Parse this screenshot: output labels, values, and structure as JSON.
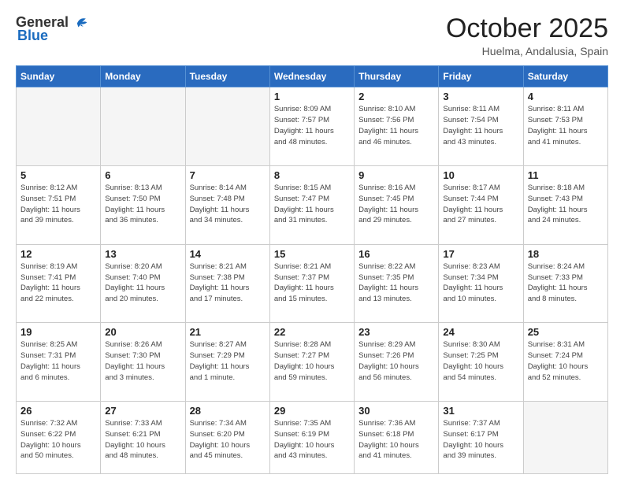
{
  "header": {
    "logo_general": "General",
    "logo_blue": "Blue",
    "month_title": "October 2025",
    "location": "Huelma, Andalusia, Spain"
  },
  "weekdays": [
    "Sunday",
    "Monday",
    "Tuesday",
    "Wednesday",
    "Thursday",
    "Friday",
    "Saturday"
  ],
  "weeks": [
    [
      {
        "day": "",
        "info": ""
      },
      {
        "day": "",
        "info": ""
      },
      {
        "day": "",
        "info": ""
      },
      {
        "day": "1",
        "info": "Sunrise: 8:09 AM\nSunset: 7:57 PM\nDaylight: 11 hours\nand 48 minutes."
      },
      {
        "day": "2",
        "info": "Sunrise: 8:10 AM\nSunset: 7:56 PM\nDaylight: 11 hours\nand 46 minutes."
      },
      {
        "day": "3",
        "info": "Sunrise: 8:11 AM\nSunset: 7:54 PM\nDaylight: 11 hours\nand 43 minutes."
      },
      {
        "day": "4",
        "info": "Sunrise: 8:11 AM\nSunset: 7:53 PM\nDaylight: 11 hours\nand 41 minutes."
      }
    ],
    [
      {
        "day": "5",
        "info": "Sunrise: 8:12 AM\nSunset: 7:51 PM\nDaylight: 11 hours\nand 39 minutes."
      },
      {
        "day": "6",
        "info": "Sunrise: 8:13 AM\nSunset: 7:50 PM\nDaylight: 11 hours\nand 36 minutes."
      },
      {
        "day": "7",
        "info": "Sunrise: 8:14 AM\nSunset: 7:48 PM\nDaylight: 11 hours\nand 34 minutes."
      },
      {
        "day": "8",
        "info": "Sunrise: 8:15 AM\nSunset: 7:47 PM\nDaylight: 11 hours\nand 31 minutes."
      },
      {
        "day": "9",
        "info": "Sunrise: 8:16 AM\nSunset: 7:45 PM\nDaylight: 11 hours\nand 29 minutes."
      },
      {
        "day": "10",
        "info": "Sunrise: 8:17 AM\nSunset: 7:44 PM\nDaylight: 11 hours\nand 27 minutes."
      },
      {
        "day": "11",
        "info": "Sunrise: 8:18 AM\nSunset: 7:43 PM\nDaylight: 11 hours\nand 24 minutes."
      }
    ],
    [
      {
        "day": "12",
        "info": "Sunrise: 8:19 AM\nSunset: 7:41 PM\nDaylight: 11 hours\nand 22 minutes."
      },
      {
        "day": "13",
        "info": "Sunrise: 8:20 AM\nSunset: 7:40 PM\nDaylight: 11 hours\nand 20 minutes."
      },
      {
        "day": "14",
        "info": "Sunrise: 8:21 AM\nSunset: 7:38 PM\nDaylight: 11 hours\nand 17 minutes."
      },
      {
        "day": "15",
        "info": "Sunrise: 8:21 AM\nSunset: 7:37 PM\nDaylight: 11 hours\nand 15 minutes."
      },
      {
        "day": "16",
        "info": "Sunrise: 8:22 AM\nSunset: 7:35 PM\nDaylight: 11 hours\nand 13 minutes."
      },
      {
        "day": "17",
        "info": "Sunrise: 8:23 AM\nSunset: 7:34 PM\nDaylight: 11 hours\nand 10 minutes."
      },
      {
        "day": "18",
        "info": "Sunrise: 8:24 AM\nSunset: 7:33 PM\nDaylight: 11 hours\nand 8 minutes."
      }
    ],
    [
      {
        "day": "19",
        "info": "Sunrise: 8:25 AM\nSunset: 7:31 PM\nDaylight: 11 hours\nand 6 minutes."
      },
      {
        "day": "20",
        "info": "Sunrise: 8:26 AM\nSunset: 7:30 PM\nDaylight: 11 hours\nand 3 minutes."
      },
      {
        "day": "21",
        "info": "Sunrise: 8:27 AM\nSunset: 7:29 PM\nDaylight: 11 hours\nand 1 minute."
      },
      {
        "day": "22",
        "info": "Sunrise: 8:28 AM\nSunset: 7:27 PM\nDaylight: 10 hours\nand 59 minutes."
      },
      {
        "day": "23",
        "info": "Sunrise: 8:29 AM\nSunset: 7:26 PM\nDaylight: 10 hours\nand 56 minutes."
      },
      {
        "day": "24",
        "info": "Sunrise: 8:30 AM\nSunset: 7:25 PM\nDaylight: 10 hours\nand 54 minutes."
      },
      {
        "day": "25",
        "info": "Sunrise: 8:31 AM\nSunset: 7:24 PM\nDaylight: 10 hours\nand 52 minutes."
      }
    ],
    [
      {
        "day": "26",
        "info": "Sunrise: 7:32 AM\nSunset: 6:22 PM\nDaylight: 10 hours\nand 50 minutes."
      },
      {
        "day": "27",
        "info": "Sunrise: 7:33 AM\nSunset: 6:21 PM\nDaylight: 10 hours\nand 48 minutes."
      },
      {
        "day": "28",
        "info": "Sunrise: 7:34 AM\nSunset: 6:20 PM\nDaylight: 10 hours\nand 45 minutes."
      },
      {
        "day": "29",
        "info": "Sunrise: 7:35 AM\nSunset: 6:19 PM\nDaylight: 10 hours\nand 43 minutes."
      },
      {
        "day": "30",
        "info": "Sunrise: 7:36 AM\nSunset: 6:18 PM\nDaylight: 10 hours\nand 41 minutes."
      },
      {
        "day": "31",
        "info": "Sunrise: 7:37 AM\nSunset: 6:17 PM\nDaylight: 10 hours\nand 39 minutes."
      },
      {
        "day": "",
        "info": ""
      }
    ]
  ]
}
